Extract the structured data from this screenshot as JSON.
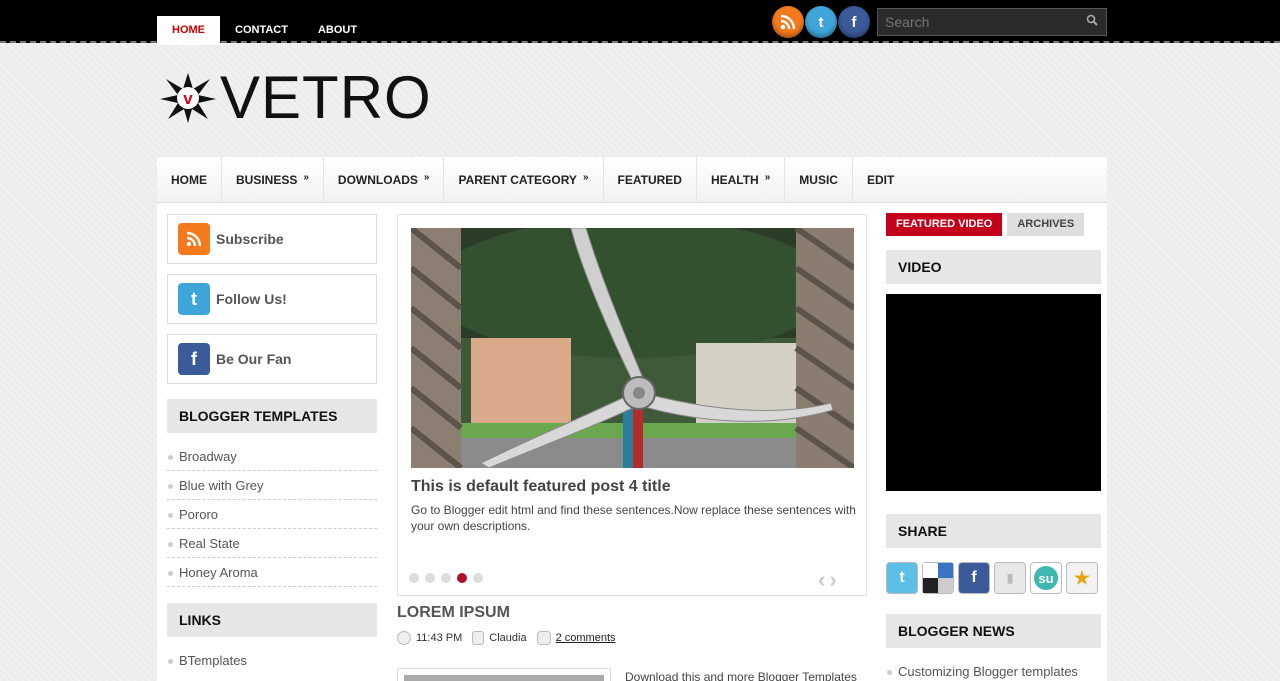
{
  "topnav": {
    "items": [
      "HOME",
      "CONTACT",
      "ABOUT"
    ]
  },
  "social_top": [
    "rss-icon",
    "twitter-icon",
    "facebook-icon"
  ],
  "search": {
    "placeholder": "Search"
  },
  "logo": {
    "text": "VETRO",
    "badge": "v"
  },
  "mainmenu": {
    "items": [
      {
        "label": "HOME",
        "has_sub": false
      },
      {
        "label": "BUSINESS",
        "has_sub": true
      },
      {
        "label": "DOWNLOADS",
        "has_sub": true
      },
      {
        "label": "PARENT CATEGORY",
        "has_sub": true
      },
      {
        "label": "FEATURED",
        "has_sub": false
      },
      {
        "label": "HEALTH",
        "has_sub": true
      },
      {
        "label": "MUSIC",
        "has_sub": false
      },
      {
        "label": "EDIT",
        "has_sub": false
      }
    ],
    "sub_arrow": "»"
  },
  "left_sidebar": {
    "subscribe": "Subscribe",
    "follow": "Follow Us!",
    "fan": "Be Our Fan",
    "blogger_templates_title": "BLOGGER TEMPLATES",
    "blogger_templates": [
      "Broadway",
      "Blue with Grey",
      "Pororo",
      "Real State",
      "Honey Aroma"
    ],
    "links_title": "LINKS",
    "links": [
      "BTemplates"
    ]
  },
  "slider": {
    "title": "This is default featured post 4 title",
    "description": "Go to Blogger edit html and find these sentences.Now replace these sentences with your own descriptions.",
    "dots": 5,
    "active_dot": 4,
    "prev": "‹",
    "next": "›"
  },
  "post": {
    "title": "LOREM IPSUM",
    "time": "11:43 PM",
    "author": "Claudia",
    "comments": "2 comments",
    "snippet": "Download this and more Blogger Templates"
  },
  "right_sidebar": {
    "tab_featured": "FEATURED VIDEO",
    "tab_archives": "ARCHIVES",
    "video_title": "VIDEO",
    "share_title": "SHARE",
    "share_icons": [
      "twitter-icon",
      "delicious-icon",
      "facebook-icon",
      "digg-icon",
      "stumbleupon-icon",
      "favorite-icon"
    ],
    "news_title": "BLOGGER NEWS",
    "news": [
      "Customizing Blogger templates"
    ]
  },
  "colors": {
    "accent": "#c4001d",
    "topbar": "#000000"
  }
}
